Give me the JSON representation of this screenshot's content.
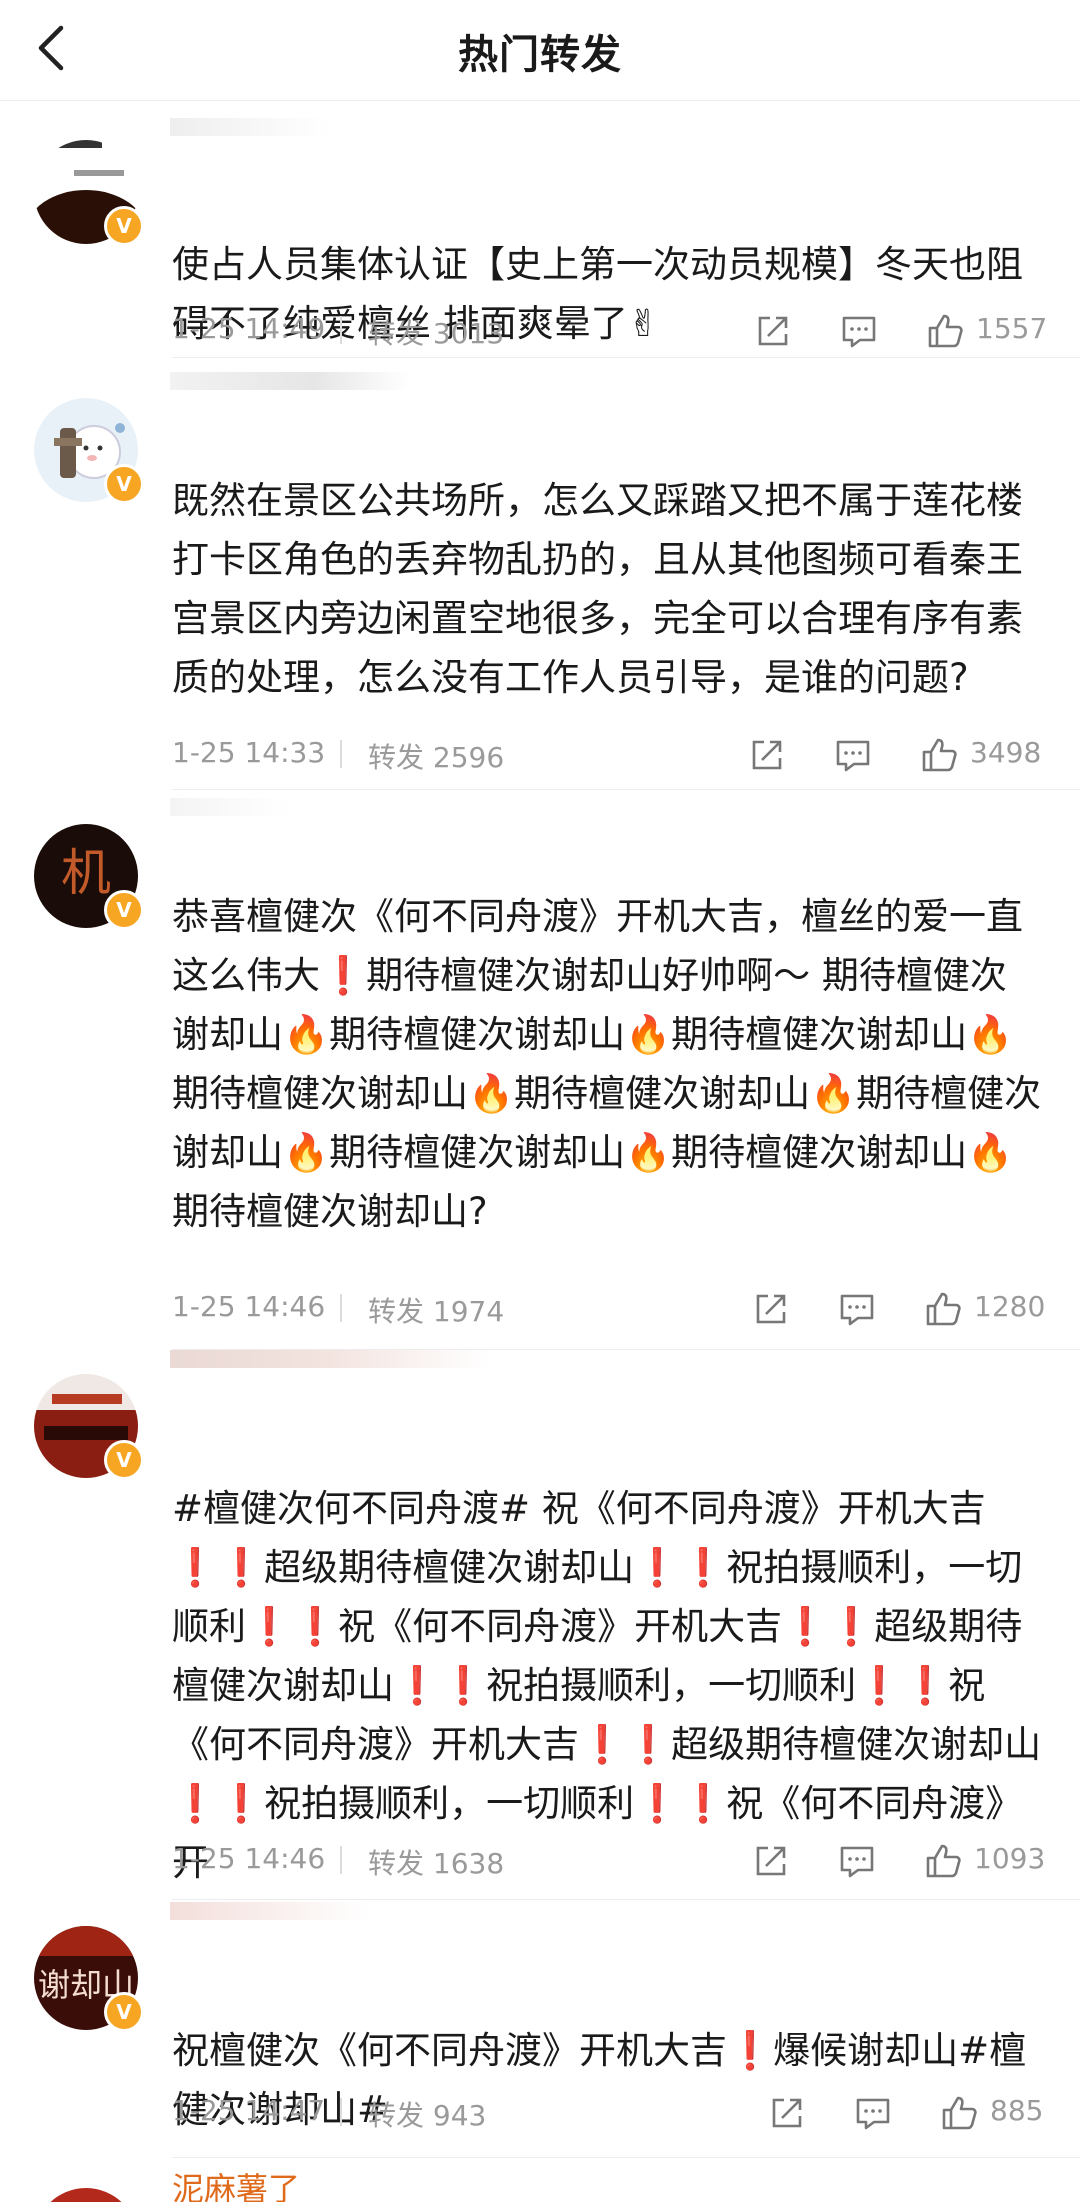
{
  "header": {
    "title": "热门转发"
  },
  "posts": [
    {
      "content_text": "使占人员集体认证【史上第一次动员规模】冬天也阻碍不了纯爱檀丝 排面爽晕了✌",
      "date": "1-25 14:49",
      "repost": "转发 3013",
      "likes": "1557"
    },
    {
      "content_text": "既然在景区公共场所，怎么又踩踏又把不属于莲花楼打卡区角色的丢弃物乱扔的，且从其他图频可看秦王宫景区内旁边闲置空地很多，完全可以合理有序有素质的处理，怎么没有工作人员引导，是谁的问题?",
      "date": "1-25 14:33",
      "repost": "转发 2596",
      "likes": "3498"
    },
    {
      "content_text": "恭喜檀健次《何不同舟渡》开机大吉，檀丝的爱一直这么伟大❗期待檀健次谢却山好帅啊～ 期待檀健次谢却山🔥期待檀健次谢却山🔥期待檀健次谢却山🔥期待檀健次谢却山🔥期待檀健次谢却山🔥期待檀健次谢却山🔥期待檀健次谢却山🔥期待檀健次谢却山🔥期待檀健次谢却山?",
      "date": "1-25 14:46",
      "repost": "转发 1974",
      "likes": "1280"
    },
    {
      "content_text": "#檀健次何不同舟渡# 祝《何不同舟渡》开机大吉❗❗超级期待檀健次谢却山❗❗祝拍摄顺利，一切顺利❗❗祝《何不同舟渡》开机大吉❗❗超级期待檀健次谢却山❗❗祝拍摄顺利，一切顺利❗❗祝《何不同舟渡》开机大吉❗❗超级期待檀健次谢却山❗❗祝拍摄顺利，一切顺利❗❗祝《何不同舟渡》开",
      "hashtag": "#檀健次何不同舟渡#",
      "date": "1-25 14:46",
      "repost": "转发 1638",
      "likes": "1093"
    },
    {
      "content_text": "祝檀健次《何不同舟渡》开机大吉❗爆候谢却山#檀健次谢却山#",
      "hashtag": "#檀健次谢却山#",
      "date": "1-25 14:47",
      "repost": "转发 943",
      "likes": "885"
    }
  ],
  "partial_post": {
    "name": "泥麻薯了"
  },
  "avatars": [
    "avatar-dark",
    "avatar-cartoon",
    "avatar-red-calligraphy",
    "avatar-red-photo",
    "avatar-calligraphy-xiequeshan"
  ],
  "icons": [
    "chevron-left-icon",
    "share-icon",
    "comment-icon",
    "like-icon",
    "verified-icon"
  ],
  "colors": {
    "link": "#4a79b4",
    "verified": "#f6a623",
    "meta_gray": "#9a9a9a",
    "alert_red": "#e0231b"
  }
}
